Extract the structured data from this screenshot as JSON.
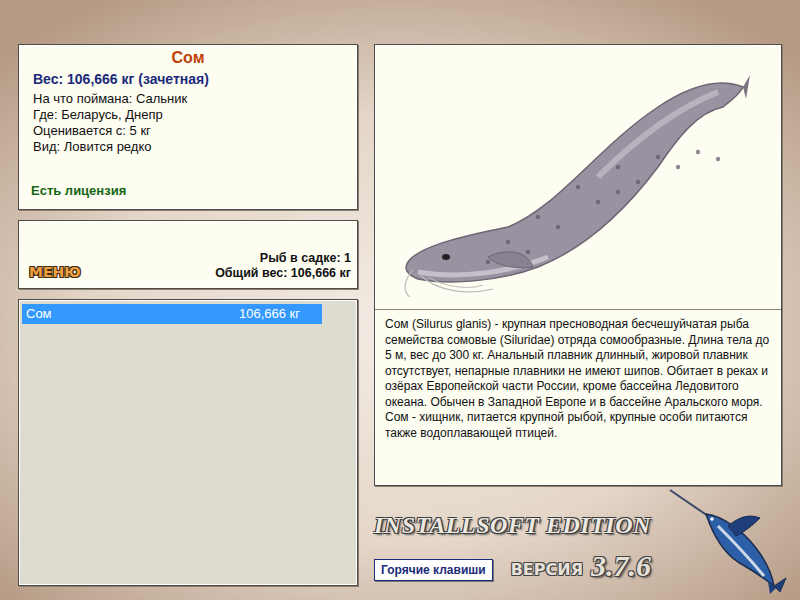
{
  "fish_card": {
    "name": "Сом",
    "weight": "Вес: 106,666 кг (зачетная)",
    "details": [
      "На что поймана: Сальник",
      "Где: Беларусь, Днепр",
      "Оценивается с: 5 кг",
      "Вид: Ловится редко"
    ],
    "license": "Есть лицензия"
  },
  "menu_button": "МЕНЮ",
  "keepnet": {
    "count": "Рыб в садке: 1",
    "total": "Общий вес: 106,666 кг"
  },
  "catch_list": [
    {
      "name": "Сом",
      "weight": "106,666 кг",
      "selected": true
    }
  ],
  "description": "Сом (Silurus glanis) - крупная пресноводная бесчешуйчатая рыба семейства сомовые (Siluridae) отряда сомообразные. Длина тела до 5 м, вес до 300 кг. Анальный плавник длинный, жировой плавник отсутствует, непарные плавники не имеют шипов. Обитает в реках и озёрах Европейской части России, кроме бассейна Ледовитого океана. Обычен в Западной Европе и в бассейне Аральского моря. Сом - хищник, питается крупной рыбой, крупные особи питаются также водоплавающей птицей.",
  "hotkeys_button": "Горячие клавиши",
  "logo": {
    "edition": "INSTALLSOFT EDITION",
    "version_label": "ВЕРСИЯ",
    "version": "3.7.6"
  }
}
